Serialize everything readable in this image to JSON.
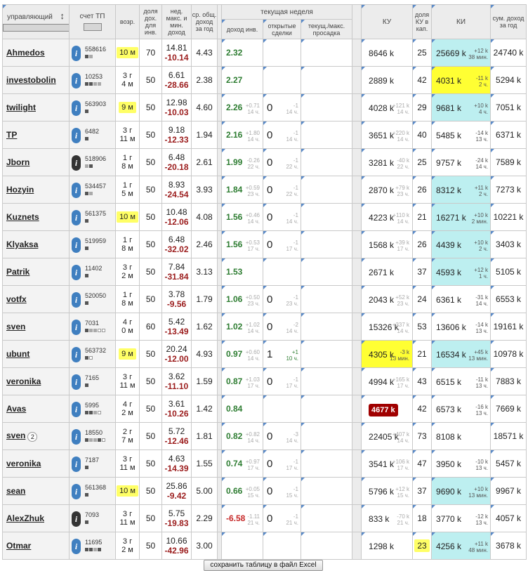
{
  "header": {
    "manager": "управляющий",
    "account": "счет ТП",
    "age": "возр.",
    "share": "доля дох. для инв.",
    "week_maxmin": "нед. макс. и мин. доход",
    "avg": "ср. общ. доход за год",
    "current_week": "текущая неделя",
    "income": "доход инв.",
    "open_deals": "открытые сделки",
    "drawdown": "текущ./макс. просадка",
    "ku": "КУ",
    "ku_share": "доля КУ в кап.",
    "ki": "КИ",
    "sum_year": "сум. доход за год"
  },
  "save_button": "сохранить таблицу в файл Excel",
  "rows": [
    {
      "name": "Ahmedos",
      "badge": "",
      "acc": "558616",
      "icon": "info",
      "sq": "DL",
      "age": "10 м",
      "age_hl": true,
      "share": "70",
      "max": "14.81",
      "min": "-10.14",
      "avg": "4.43",
      "inc": "2.32",
      "inc_neg": false,
      "inc_sub1": "",
      "inc_sub2": "",
      "open": "",
      "open_sub1": "",
      "open_sub2": "",
      "ku": "8646 k",
      "ku_hl": "",
      "ku_sub1": "",
      "ku_sub2": "",
      "ku_share": "25",
      "ku_share_hl": false,
      "ki": "25669 k",
      "ki_bg": "cyan",
      "ki_sub1": "+12 k",
      "ki_sub2": "38 мин.",
      "sum": "24740 k"
    },
    {
      "name": "investobolin",
      "badge": "",
      "acc": "10253",
      "icon": "info",
      "sq": "DDLL",
      "age": "3 г\n4 м",
      "age_hl": false,
      "share": "50",
      "max": "6.61",
      "min": "-28.66",
      "avg": "2.38",
      "inc": "2.27",
      "inc_neg": false,
      "inc_sub1": "",
      "inc_sub2": "",
      "open": "",
      "open_sub1": "",
      "open_sub2": "",
      "ku": "2889 k",
      "ku_hl": "",
      "ku_sub1": "",
      "ku_sub2": "",
      "ku_share": "42",
      "ku_share_hl": false,
      "ki": "4031 k",
      "ki_bg": "yellow",
      "ki_sub1": "-11 k",
      "ki_sub2": "2 ч.",
      "sum": "5294 k"
    },
    {
      "name": "twilight",
      "badge": "",
      "acc": "563903",
      "icon": "info",
      "sq": "D",
      "age": "9 м",
      "age_hl": true,
      "share": "50",
      "max": "12.98",
      "min": "-10.03",
      "avg": "4.60",
      "inc": "2.26",
      "inc_neg": false,
      "inc_sub1": "+0.71",
      "inc_sub2": "14 ч.",
      "open": "0",
      "open_sub1": "-1",
      "open_sub2": "14 ч.",
      "ku": "4028 k",
      "ku_hl": "",
      "ku_sub1": "+121 k",
      "ku_sub2": "14 ч.",
      "ku_share": "29",
      "ku_share_hl": false,
      "ki": "9681 k",
      "ki_bg": "cyan",
      "ki_sub1": "+10 k",
      "ki_sub2": "4 ч.",
      "sum": "7051 k"
    },
    {
      "name": "TP",
      "badge": "",
      "acc": "6482",
      "icon": "info",
      "sq": "D",
      "age": "3 г\n11 м",
      "age_hl": false,
      "share": "50",
      "max": "9.18",
      "min": "-12.33",
      "avg": "1.94",
      "inc": "2.16",
      "inc_neg": false,
      "inc_sub1": "+1.80",
      "inc_sub2": "14 ч.",
      "open": "0",
      "open_sub1": "-1",
      "open_sub2": "14 ч.",
      "ku": "3651 k",
      "ku_hl": "",
      "ku_sub1": "+220 k",
      "ku_sub2": "14 ч.",
      "ku_share": "40",
      "ku_share_hl": false,
      "ki": "5485 k",
      "ki_bg": "",
      "ki_sub1": "-14 k",
      "ki_sub2": "13 ч.",
      "sum": "6371 k"
    },
    {
      "name": "Jborn",
      "badge": "",
      "acc": "518906",
      "icon": "dark",
      "sq": "LD",
      "age": "1 г\n8 м",
      "age_hl": false,
      "share": "50",
      "max": "6.48",
      "min": "-20.18",
      "avg": "2.61",
      "inc": "1.99",
      "inc_neg": false,
      "inc_sub1": "-0.26",
      "inc_sub2": "22 ч.",
      "open": "0",
      "open_sub1": "-1",
      "open_sub2": "22 ч.",
      "ku": "3281 k",
      "ku_hl": "",
      "ku_sub1": "-40 k",
      "ku_sub2": "22 ч.",
      "ku_share": "25",
      "ku_share_hl": false,
      "ki": "9757 k",
      "ki_bg": "",
      "ki_sub1": "-24 k",
      "ki_sub2": "14 ч.",
      "sum": "7589 k"
    },
    {
      "name": "Hozyin",
      "badge": "",
      "acc": "534457",
      "icon": "info",
      "sq": "DL",
      "age": "1 г\n5 м",
      "age_hl": false,
      "share": "50",
      "max": "8.93",
      "min": "-24.54",
      "avg": "3.93",
      "inc": "1.84",
      "inc_neg": false,
      "inc_sub1": "+0.59",
      "inc_sub2": "23 ч.",
      "open": "0",
      "open_sub1": "-1",
      "open_sub2": "22 ч.",
      "ku": "2870 k",
      "ku_hl": "",
      "ku_sub1": "+79 k",
      "ku_sub2": "23 ч.",
      "ku_share": "26",
      "ku_share_hl": false,
      "ki": "8312 k",
      "ki_bg": "cyan",
      "ki_sub1": "+11 k",
      "ki_sub2": "2 ч.",
      "sum": "7273 k"
    },
    {
      "name": "Kuznets",
      "badge": "",
      "acc": "561375",
      "icon": "info",
      "sq": "D",
      "age": "10 м",
      "age_hl": true,
      "share": "50",
      "max": "10.48",
      "min": "-12.06",
      "avg": "4.08",
      "inc": "1.56",
      "inc_neg": false,
      "inc_sub1": "+0.46",
      "inc_sub2": "14 ч.",
      "open": "0",
      "open_sub1": "-1",
      "open_sub2": "14 ч.",
      "ku": "4223 k",
      "ku_hl": "",
      "ku_sub1": "+110 k",
      "ku_sub2": "14 ч.",
      "ku_share": "21",
      "ku_share_hl": false,
      "ki": "16271 k",
      "ki_bg": "cyan",
      "ki_sub1": "+10 k",
      "ki_sub2": "2 мин.",
      "sum": "10221 k"
    },
    {
      "name": "Klyaksa",
      "badge": "",
      "acc": "519959",
      "icon": "info",
      "sq": "D",
      "age": "1 г\n8 м",
      "age_hl": false,
      "share": "50",
      "max": "6.48",
      "min": "-32.02",
      "avg": "2.46",
      "inc": "1.56",
      "inc_neg": false,
      "inc_sub1": "+0.53",
      "inc_sub2": "17 ч.",
      "open": "0",
      "open_sub1": "-1",
      "open_sub2": "17 ч.",
      "ku": "1568 k",
      "ku_hl": "",
      "ku_sub1": "+39 k",
      "ku_sub2": "17 ч.",
      "ku_share": "26",
      "ku_share_hl": false,
      "ki": "4439 k",
      "ki_bg": "cyan",
      "ki_sub1": "+10 k",
      "ki_sub2": "2 ч.",
      "sum": "3403 k"
    },
    {
      "name": "Patrik",
      "badge": "",
      "acc": "11402",
      "icon": "info",
      "sq": "D",
      "age": "3 г\n2 м",
      "age_hl": false,
      "share": "50",
      "max": "7.84",
      "min": "-31.84",
      "avg": "3.13",
      "inc": "1.53",
      "inc_neg": false,
      "inc_sub1": "",
      "inc_sub2": "",
      "open": "",
      "open_sub1": "",
      "open_sub2": "",
      "ku": "2671 k",
      "ku_hl": "",
      "ku_sub1": "",
      "ku_sub2": "",
      "ku_share": "37",
      "ku_share_hl": false,
      "ki": "4593 k",
      "ki_bg": "cyan",
      "ki_sub1": "+12 k",
      "ki_sub2": "1 ч.",
      "sum": "5105 k"
    },
    {
      "name": "votfx",
      "badge": "",
      "acc": "520050",
      "icon": "info",
      "sq": "D",
      "age": "1 г\n8 м",
      "age_hl": false,
      "share": "50",
      "max": "3.78",
      "min": "-9.56",
      "avg": "1.79",
      "inc": "1.06",
      "inc_neg": false,
      "inc_sub1": "+0.50",
      "inc_sub2": "23 ч.",
      "open": "0",
      "open_sub1": "-1",
      "open_sub2": "23 ч.",
      "ku": "2043 k",
      "ku_hl": "",
      "ku_sub1": "+52 k",
      "ku_sub2": "23 ч.",
      "ku_share": "24",
      "ku_share_hl": false,
      "ki": "6361 k",
      "ki_bg": "",
      "ki_sub1": "-31 k",
      "ki_sub2": "14 ч.",
      "sum": "6553 k"
    },
    {
      "name": "sven",
      "badge": "",
      "acc": "7031",
      "icon": "info",
      "sq": "DLLEE",
      "age": "4 г\n0 м",
      "age_hl": false,
      "share": "60",
      "max": "5.42",
      "min": "-13.49",
      "avg": "1.62",
      "inc": "1.02",
      "inc_neg": false,
      "inc_sub1": "+1.02",
      "inc_sub2": "14 ч.",
      "open": "0",
      "open_sub1": "-2",
      "open_sub2": "14 ч.",
      "ku": "15326 k",
      "ku_hl": "",
      "ku_sub1": "+337 k",
      "ku_sub2": "14 ч.",
      "ku_share": "53",
      "ku_share_hl": false,
      "ki": "13606 k",
      "ki_bg": "",
      "ki_sub1": "-14 k",
      "ki_sub2": "13 ч.",
      "sum": "19161 k"
    },
    {
      "name": "ubunt",
      "badge": "",
      "acc": "563732",
      "icon": "info",
      "sq": "DE",
      "age": "9 м",
      "age_hl": true,
      "share": "50",
      "max": "20.24",
      "min": "-12.00",
      "avg": "4.93",
      "inc": "0.97",
      "inc_neg": false,
      "inc_sub1": "+0.60",
      "inc_sub2": "14 ч.",
      "open": "1",
      "open_sub1": "+1",
      "open_sub2": "10 ч.",
      "ku": "4305 k",
      "ku_hl": "yellow",
      "ku_sub1": "-3 k",
      "ku_sub2": "13 мин.",
      "ku_share": "21",
      "ku_share_hl": false,
      "ki": "16534 k",
      "ki_bg": "cyan",
      "ki_sub1": "+45 k",
      "ki_sub2": "13 мин.",
      "sum": "10978 k"
    },
    {
      "name": "veronika",
      "badge": "",
      "acc": "7165",
      "icon": "info",
      "sq": "D",
      "age": "3 г\n11 м",
      "age_hl": false,
      "share": "50",
      "max": "3.62",
      "min": "-11.10",
      "avg": "1.59",
      "inc": "0.87",
      "inc_neg": false,
      "inc_sub1": "+1.03",
      "inc_sub2": "17 ч.",
      "open": "0",
      "open_sub1": "-1",
      "open_sub2": "17 ч.",
      "ku": "4994 k",
      "ku_hl": "",
      "ku_sub1": "+165 k",
      "ku_sub2": "17 ч.",
      "ku_share": "43",
      "ku_share_hl": false,
      "ki": "6515 k",
      "ki_bg": "",
      "ki_sub1": "-11 k",
      "ki_sub2": "13 ч.",
      "sum": "7883 k"
    },
    {
      "name": "Avas",
      "badge": "",
      "acc": "5995",
      "icon": "info",
      "sq": "DDLE",
      "age": "4 г\n2 м",
      "age_hl": false,
      "share": "50",
      "max": "3.61",
      "min": "-10.26",
      "avg": "1.42",
      "inc": "0.84",
      "inc_neg": false,
      "inc_sub1": "",
      "inc_sub2": "",
      "open": "",
      "open_sub1": "",
      "open_sub2": "",
      "ku": "4677 k",
      "ku_hl": "red",
      "ku_sub1": "",
      "ku_sub2": "",
      "ku_share": "42",
      "ku_share_hl": false,
      "ki": "6573 k",
      "ki_bg": "",
      "ki_sub1": "-16 k",
      "ki_sub2": "13 ч.",
      "sum": "7669 k"
    },
    {
      "name": "sven",
      "badge": "2",
      "acc": "18550",
      "icon": "info",
      "sq": "DLLDE",
      "age": "2 г\n7 м",
      "age_hl": false,
      "share": "50",
      "max": "5.72",
      "min": "-12.46",
      "avg": "1.81",
      "inc": "0.82",
      "inc_neg": false,
      "inc_sub1": "+0.82",
      "inc_sub2": "14 ч.",
      "open": "0",
      "open_sub1": "-3",
      "open_sub2": "14 ч.",
      "ku": "22405 k",
      "ku_hl": "",
      "ku_sub1": "+407 k",
      "ku_sub2": "14 ч.",
      "ku_share": "73",
      "ku_share_hl": false,
      "ki": "8108 k",
      "ki_bg": "",
      "ki_sub1": "",
      "ki_sub2": "",
      "sum": "18571 k"
    },
    {
      "name": "veronika",
      "badge": "",
      "acc": "7187",
      "icon": "info",
      "sq": "D",
      "age": "3 г\n11 м",
      "age_hl": false,
      "share": "50",
      "max": "4.63",
      "min": "-14.39",
      "avg": "1.55",
      "inc": "0.74",
      "inc_neg": false,
      "inc_sub1": "+0.97",
      "inc_sub2": "17 ч.",
      "open": "0",
      "open_sub1": "-1",
      "open_sub2": "17 ч.",
      "ku": "3541 k",
      "ku_hl": "",
      "ku_sub1": "+106 k",
      "ku_sub2": "17 ч.",
      "ku_share": "47",
      "ku_share_hl": false,
      "ki": "3950 k",
      "ki_bg": "",
      "ki_sub1": "-10 k",
      "ki_sub2": "13 ч.",
      "sum": "5457 k"
    },
    {
      "name": "sean",
      "badge": "",
      "acc": "561368",
      "icon": "info",
      "sq": "D",
      "age": "10 м",
      "age_hl": true,
      "share": "50",
      "max": "25.86",
      "min": "-9.42",
      "avg": "5.00",
      "inc": "0.66",
      "inc_neg": false,
      "inc_sub1": "+0.05",
      "inc_sub2": "15 ч.",
      "open": "0",
      "open_sub1": "-1",
      "open_sub2": "15 ч.",
      "ku": "5796 k",
      "ku_hl": "",
      "ku_sub1": "+12 k",
      "ku_sub2": "15 ч.",
      "ku_share": "37",
      "ku_share_hl": false,
      "ki": "9690 k",
      "ki_bg": "cyan",
      "ki_sub1": "+10 k",
      "ki_sub2": "13 мин.",
      "sum": "9967 k"
    },
    {
      "name": "AlexZhuk",
      "badge": "",
      "acc": "7093",
      "icon": "dark",
      "sq": "D",
      "age": "3 г\n11 м",
      "age_hl": false,
      "share": "50",
      "max": "5.75",
      "min": "-19.83",
      "avg": "2.29",
      "inc": "-6.58",
      "inc_neg": true,
      "inc_sub1": "-1.11",
      "inc_sub2": "21 ч.",
      "open": "0",
      "open_sub1": "-1",
      "open_sub2": "21 ч.",
      "ku": "833 k",
      "ku_hl": "",
      "ku_sub1": "-70 k",
      "ku_sub2": "21 ч.",
      "ku_share": "18",
      "ku_share_hl": false,
      "ki": "3770 k",
      "ki_bg": "",
      "ki_sub1": "-12 k",
      "ki_sub2": "13 ч.",
      "sum": "4057 k"
    },
    {
      "name": "Otmar",
      "badge": "",
      "acc": "11695",
      "icon": "info",
      "sq": "DDLD",
      "age": "3 г\n2 м",
      "age_hl": false,
      "share": "50",
      "max": "10.66",
      "min": "-42.96",
      "avg": "3.00",
      "inc": "",
      "inc_neg": false,
      "inc_sub1": "",
      "inc_sub2": "",
      "open": "",
      "open_sub1": "",
      "open_sub2": "",
      "ku": "1298 k",
      "ku_hl": "",
      "ku_sub1": "",
      "ku_sub2": "",
      "ku_share": "23",
      "ku_share_hl": true,
      "ki": "4256 k",
      "ki_bg": "cyan",
      "ki_sub1": "+11 k",
      "ki_sub2": "48 мин.",
      "sum": "3678 k"
    }
  ]
}
